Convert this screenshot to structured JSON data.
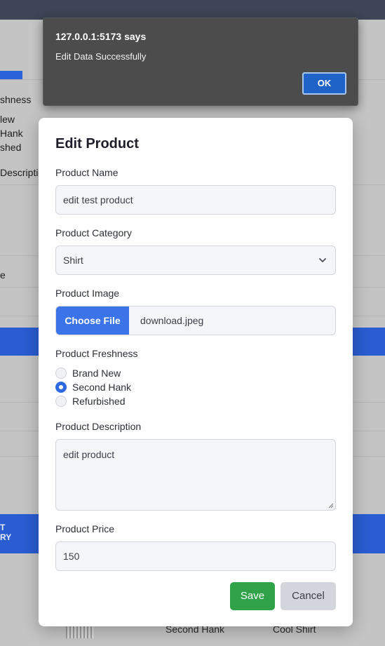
{
  "background": {
    "labels": [
      "shness",
      "lew",
      "Hank",
      "shed",
      "Descriptio",
      "e"
    ],
    "band_text": [
      "T",
      "RY"
    ],
    "row": {
      "freshness": "Second Hank",
      "name": "Cool Shirt"
    }
  },
  "alert": {
    "title": "127.0.0.1:5173 says",
    "message": "Edit Data Successfully",
    "ok_label": "OK"
  },
  "modal": {
    "title": "Edit Product",
    "name": {
      "label": "Product Name",
      "value": "edit test product"
    },
    "category": {
      "label": "Product Category",
      "value": "Shirt"
    },
    "image": {
      "label": "Product Image",
      "button_label": "Choose File",
      "file_name": "download.jpeg"
    },
    "freshness": {
      "label": "Product Freshness",
      "options": [
        "Brand New",
        "Second Hank",
        "Refurbished"
      ],
      "selected": "Second Hank"
    },
    "description": {
      "label": "Product Description",
      "value": "edit product"
    },
    "price": {
      "label": "Product Price",
      "value": "150"
    },
    "save_label": "Save",
    "cancel_label": "Cancel"
  },
  "colors": {
    "primary": "#3b73e8",
    "save": "#2fa24a",
    "cancel": "#d3d6dd",
    "alert_bg": "#4c4c4c"
  }
}
